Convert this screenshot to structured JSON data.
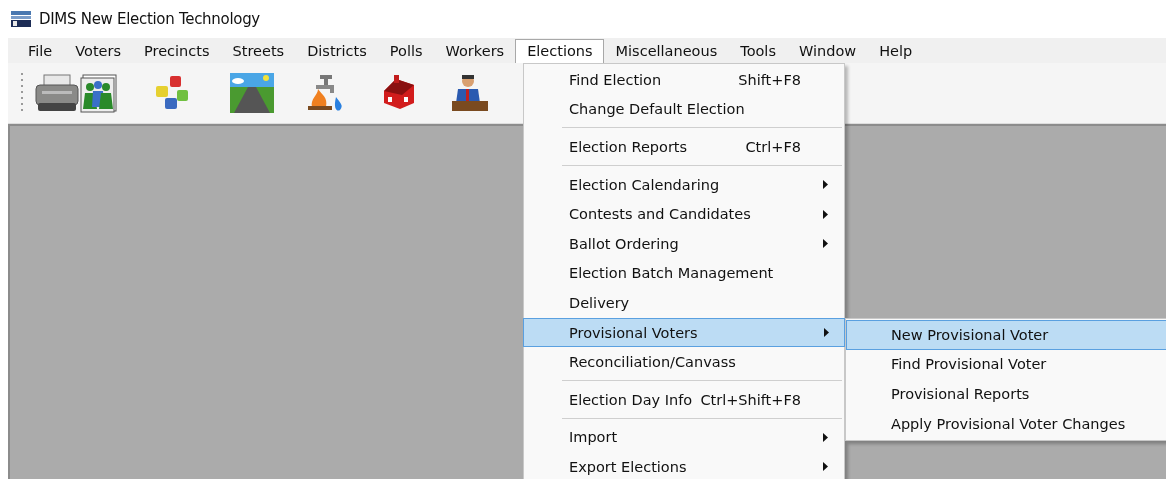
{
  "window": {
    "title": "DIMS New Election Technology"
  },
  "menu_bar": [
    {
      "label": "File",
      "selected": false
    },
    {
      "label": "Voters",
      "selected": false
    },
    {
      "label": "Precincts",
      "selected": false
    },
    {
      "label": "Streets",
      "selected": false
    },
    {
      "label": "Districts",
      "selected": false
    },
    {
      "label": "Polls",
      "selected": false
    },
    {
      "label": "Workers",
      "selected": false
    },
    {
      "label": "Elections",
      "selected": true
    },
    {
      "label": "Miscellaneous",
      "selected": false
    },
    {
      "label": "Tools",
      "selected": false
    },
    {
      "label": "Window",
      "selected": false
    },
    {
      "label": "Help",
      "selected": false
    }
  ],
  "elections_menu": [
    {
      "kind": "item",
      "label": "Find Election",
      "shortcut": "Shift+F8",
      "has_submenu": false,
      "selected": false
    },
    {
      "kind": "item",
      "label": "Change Default Election",
      "has_submenu": false,
      "selected": false
    },
    {
      "kind": "separator"
    },
    {
      "kind": "item",
      "label": "Election Reports",
      "shortcut": "Ctrl+F8",
      "has_submenu": false,
      "selected": false
    },
    {
      "kind": "separator"
    },
    {
      "kind": "item",
      "label": "Election Calendaring",
      "has_submenu": true,
      "selected": false
    },
    {
      "kind": "item",
      "label": "Contests and Candidates",
      "has_submenu": true,
      "selected": false
    },
    {
      "kind": "item",
      "label": "Ballot Ordering",
      "has_submenu": true,
      "selected": false
    },
    {
      "kind": "item",
      "label": "Election Batch Management",
      "has_submenu": false,
      "selected": false
    },
    {
      "kind": "item",
      "label": "Delivery",
      "has_submenu": false,
      "selected": false
    },
    {
      "kind": "item",
      "label": "Provisional Voters",
      "has_submenu": true,
      "selected": true
    },
    {
      "kind": "item",
      "label": "Reconciliation/Canvass",
      "has_submenu": false,
      "selected": false
    },
    {
      "kind": "separator"
    },
    {
      "kind": "item",
      "label": "Election Day Info",
      "shortcut": "Ctrl+Shift+F8",
      "has_submenu": false,
      "selected": false
    },
    {
      "kind": "separator"
    },
    {
      "kind": "item",
      "label": "Import",
      "has_submenu": true,
      "selected": false
    },
    {
      "kind": "item",
      "label": "Export Elections",
      "has_submenu": true,
      "selected": false
    }
  ],
  "provisional_submenu": [
    {
      "label": "New Provisional Voter",
      "selected": true
    },
    {
      "label": "Find Provisional Voter",
      "selected": false
    },
    {
      "label": "Provisional Reports",
      "selected": false
    },
    {
      "label": "Apply Provisional Voter Changes",
      "selected": false
    }
  ]
}
